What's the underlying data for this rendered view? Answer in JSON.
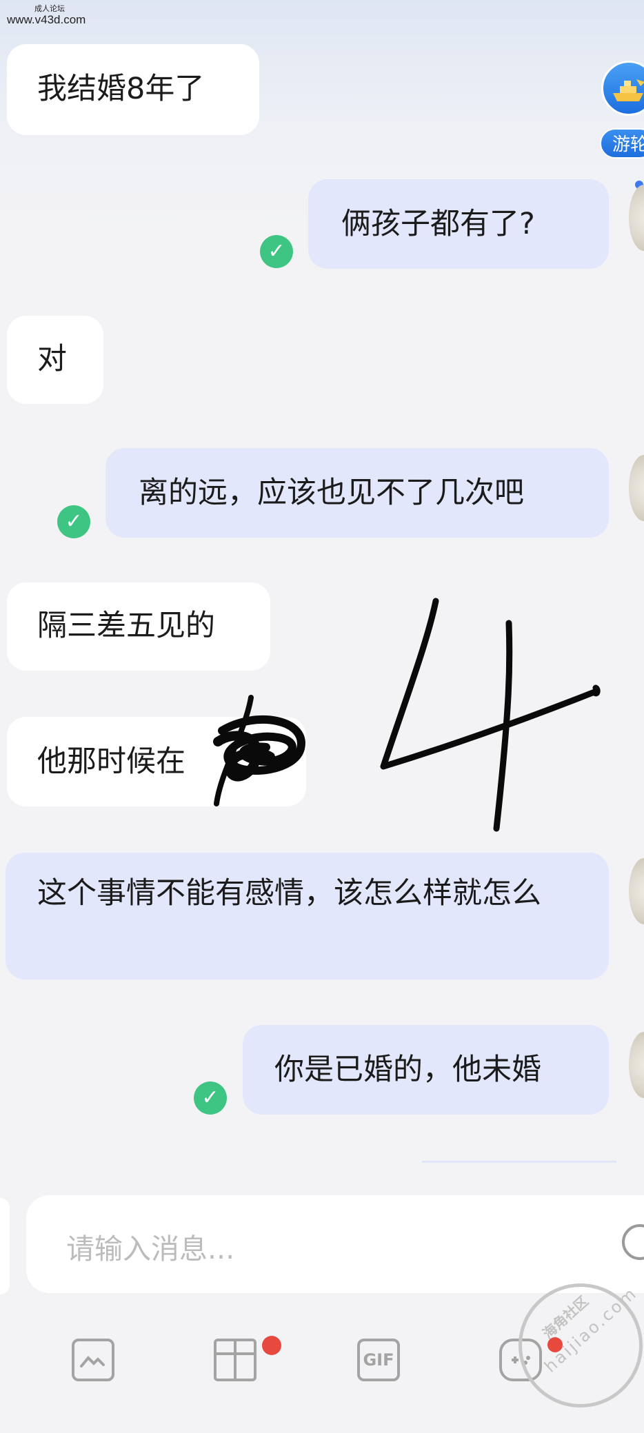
{
  "watermark": {
    "line1": "成人论坛",
    "line2": "www.v43d.com"
  },
  "badge": {
    "label": "游轮"
  },
  "messages": [
    {
      "direction": "incoming",
      "text": "我结婚8年了"
    },
    {
      "direction": "outgoing",
      "text": "俩孩子都有了?",
      "read": true
    },
    {
      "direction": "incoming",
      "text": "对"
    },
    {
      "direction": "outgoing",
      "text": "离的远，应该也见不了几次吧",
      "read": true
    },
    {
      "direction": "incoming",
      "text": "隔三差五见的"
    },
    {
      "direction": "incoming",
      "text": "他那时候在"
    },
    {
      "direction": "outgoing",
      "text": "这个事情不能有感情，该怎么样就怎么"
    },
    {
      "direction": "outgoing",
      "text": "你是已婚的，他未婚",
      "read": true
    }
  ],
  "input": {
    "placeholder": "请输入消息..."
  },
  "toolbar": {
    "gif_label": "GIF",
    "gift_has_badge": true,
    "game_has_badge": true
  },
  "colors": {
    "incoming_bubble": "#ffffff",
    "outgoing_bubble": "#e3e7fb",
    "read_check": "#3fc583",
    "badge_dot": "#e8493f",
    "unread_dot": "#3c7bf0"
  },
  "stamp": {
    "text_cn": "海角社区",
    "text_en": "haijiao.com"
  }
}
